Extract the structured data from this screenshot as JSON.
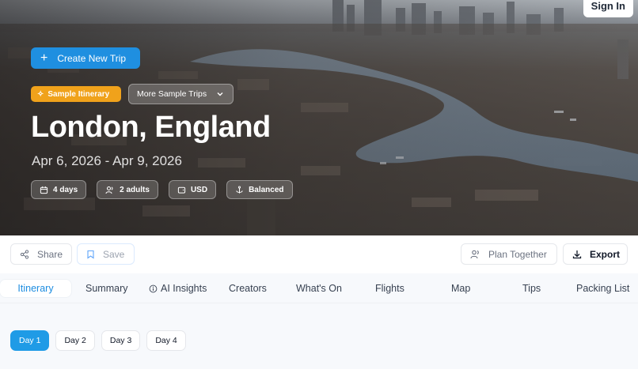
{
  "header": {
    "sign_in_label": "Sign In",
    "create_trip_label": "Create New Trip",
    "sample_badge_label": "Sample Itinerary",
    "more_samples_label": "More Sample Trips"
  },
  "trip": {
    "title": "London, England",
    "dates": "Apr 6, 2026 - Apr 9, 2026",
    "chips": [
      {
        "icon": "calendar-icon",
        "label": "4 days"
      },
      {
        "icon": "people-icon",
        "label": "2 adults"
      },
      {
        "icon": "wallet-icon",
        "label": "USD"
      },
      {
        "icon": "anchor-icon",
        "label": "Balanced"
      }
    ]
  },
  "actions": {
    "share_label": "Share",
    "save_label": "Save",
    "plan_together_label": "Plan Together",
    "export_label": "Export"
  },
  "tabs": [
    {
      "label": "Itinerary",
      "active": true
    },
    {
      "label": "Summary"
    },
    {
      "label": "AI Insights",
      "icon": "info-icon"
    },
    {
      "label": "Creators"
    },
    {
      "label": "What's On"
    },
    {
      "label": "Flights"
    },
    {
      "label": "Map"
    },
    {
      "label": "Tips"
    },
    {
      "label": "Packing List"
    }
  ],
  "days": [
    {
      "label": "Day 1",
      "active": true
    },
    {
      "label": "Day 2"
    },
    {
      "label": "Day 3"
    },
    {
      "label": "Day 4"
    }
  ],
  "colors": {
    "primary": "#1f8fe0",
    "sample_badge": "#f0a21b",
    "active_tab_text": "#1d8de0"
  }
}
